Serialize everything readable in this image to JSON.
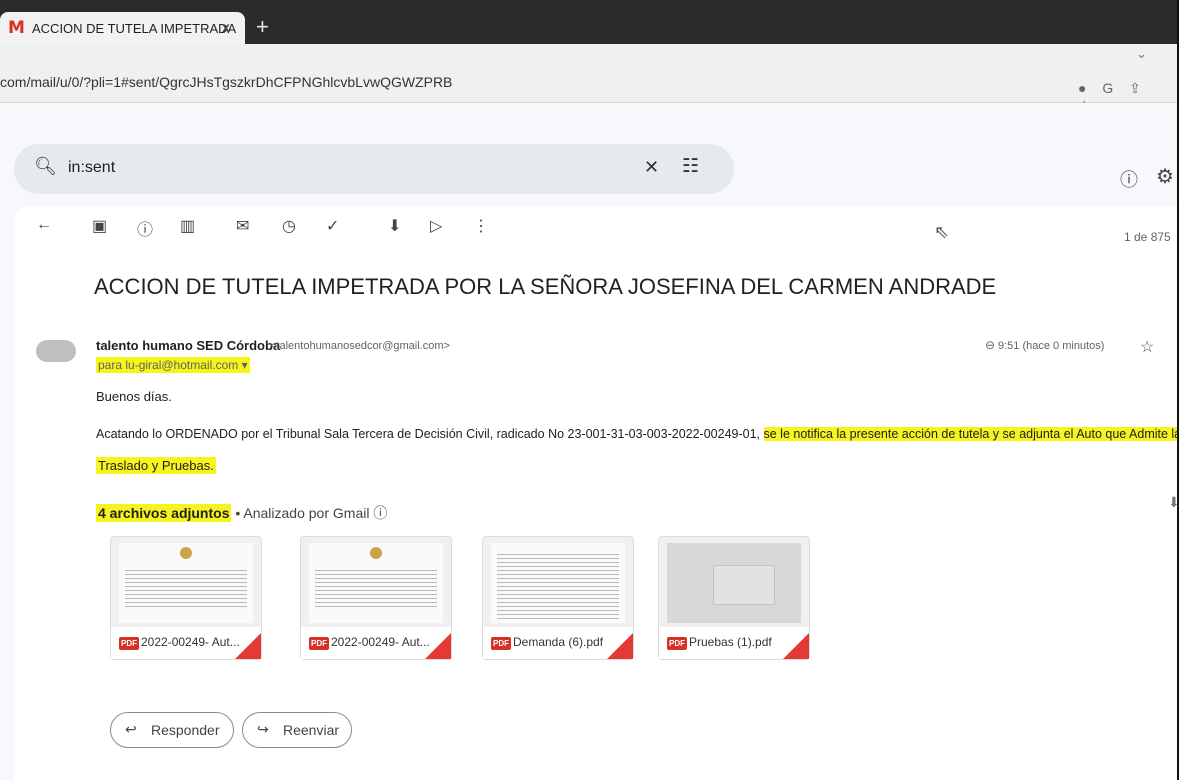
{
  "tab": {
    "favicon": "M",
    "title": "ACCION DE TUTELA IMPETRADA",
    "close": "x",
    "new_tab": "+"
  },
  "address": {
    "url": "com/mail/u/0/?pli=1#sent/QgrcJHsTgszkrDhCFPNGhlcvbLvwQGWZPRB",
    "icons": [
      "●",
      "G",
      "⇪",
      "☆"
    ]
  },
  "search": {
    "icon": "search-icon",
    "query": "in:sent"
  },
  "toolbar": {
    "counter": "1 de 875"
  },
  "email": {
    "subject": "ACCION DE TUTELA IMPETRADA POR LA SEÑORA JOSEFINA DEL CARMEN ANDRADE",
    "sender_name": "talento humano SED Córdoba",
    "sender_email": "<talentohumanosedcor@gmail.com>",
    "recipient": "para lu-giral@hotmail.com ▾",
    "time": "9:51 (hace 0 minutos)",
    "greeting": "Buenos días.",
    "body_line1_plain": "Acatando lo ORDENADO por el Tribunal Sala Tercera de Decisión Civil, radicado No 23-001-31-03-003-2022-00249-01, ",
    "body_line1_highlight": "se le notifica la presente acción de tutela y se adjunta el  Auto que Admite la Tut",
    "body_line2": "Traslado y Pruebas."
  },
  "attachments": {
    "count_label": "4 archivos adjuntos",
    "scanned_label": "• Analizado por Gmail ⓘ",
    "items": [
      {
        "name": "2022-00249- Aut...",
        "type_badge": "PDF"
      },
      {
        "name": "2022-00249- Aut...",
        "type_badge": "PDF"
      },
      {
        "name": "Demanda (6).pdf",
        "type_badge": "PDF"
      },
      {
        "name": "Pruebas (1).pdf",
        "type_badge": "PDF"
      }
    ]
  },
  "actions": {
    "reply": "Responder",
    "forward": "Reenviar"
  },
  "colors": {
    "highlight": "#f7f31e",
    "pdf_red": "#d93025"
  }
}
